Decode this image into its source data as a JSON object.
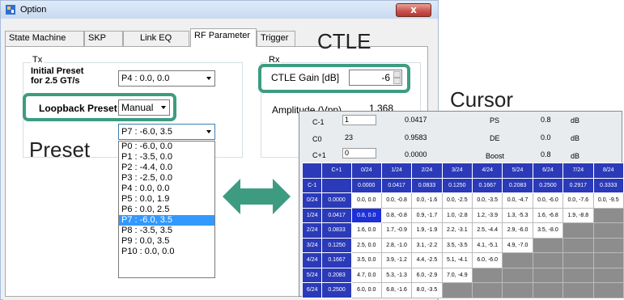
{
  "window": {
    "title": "Option",
    "close_label": "x"
  },
  "tabs": [
    {
      "label": "State Machine"
    },
    {
      "label": "SKP"
    },
    {
      "label": "Link EQ"
    },
    {
      "label": "RF Parameter"
    },
    {
      "label": "Trigger"
    }
  ],
  "tx": {
    "group_label": "Tx",
    "initial_preset_label": "Initial Preset\nfor 2.5 GT/s",
    "initial_preset_value": "P4 : 0.0, 0.0",
    "loopback_label": "Loopback Preset",
    "loopback_value": "Manual",
    "manual_value": "P7 : -6.0, 3.5"
  },
  "rx": {
    "group_label": "Rx",
    "ctle_label": "CTLE Gain [dB]",
    "ctle_value": "-6",
    "amplitude_label": "Amplitude (Vpp)",
    "amplitude_value": "1.368"
  },
  "dropdown": [
    "P0 : -6.0, 0.0",
    "P1 : -3.5, 0.0",
    "P2 : -4.4, 0.0",
    "P3 : -2.5, 0.0",
    "P4 : 0.0, 0.0",
    "P5 : 0.0, 1.9",
    "P6 : 0.0, 2.5",
    "P7 : -6.0, 3.5",
    "P8 : -3.5, 3.5",
    "P9 : 0.0, 3.5",
    "P10 : 0.0, 0.0"
  ],
  "dropdown_selected": "P7 : -6.0, 3.5",
  "annotations": {
    "ctle": "CTLE",
    "cursor": "Cursor",
    "preset": "Preset"
  },
  "cursor": {
    "c_minus1": {
      "label": "C-1",
      "value": "1",
      "computed": "0.0417"
    },
    "c0": {
      "label": "C0",
      "value": "23",
      "computed": "0.9583"
    },
    "c_plus1": {
      "label": "C+1",
      "value": "0",
      "computed": "0.0000"
    },
    "ps": {
      "label": "PS",
      "value": "0.8",
      "unit": "dB"
    },
    "de": {
      "label": "DE",
      "value": "0.0",
      "unit": "dB"
    },
    "boost": {
      "label": "Boost",
      "value": "0.8",
      "unit": "dB"
    }
  },
  "grid": {
    "corner": "C+1",
    "corner2": "C-1",
    "cols": [
      "0/24",
      "1/24",
      "2/24",
      "3/24",
      "4/24",
      "5/24",
      "6/24",
      "7/24",
      "8/24"
    ],
    "col_values": [
      "0.0000",
      "0.0417",
      "0.0833",
      "0.1250",
      "0.1667",
      "0.2083",
      "0.2500",
      "0.2917",
      "0.3333"
    ],
    "rows": [
      {
        "label": "0/24",
        "value": "0.0000",
        "cells": [
          "0.0, 0.0",
          "0.0, -0.8",
          "0.0, -1.6",
          "0.0, -2.5",
          "0.0, -3.5",
          "0.0, -4.7",
          "0.0, -6.0",
          "0.0, -7.6",
          "0.0, -9.5"
        ]
      },
      {
        "label": "1/24",
        "value": "0.0417",
        "cells": [
          "0.8, 0.0",
          "0.8, -0.8",
          "0.9, -1.7",
          "1.0, -2.8",
          "1.2, -3.9",
          "1.3, -5.3",
          "1.6, -6.8",
          "1.9, -8.8",
          ""
        ]
      },
      {
        "label": "2/24",
        "value": "0.0833",
        "cells": [
          "1.6, 0.0",
          "1.7, -0.9",
          "1.9, -1.9",
          "2.2, -3.1",
          "2.5, -4.4",
          "2.9, -6.0",
          "3.5, -8.0",
          "",
          ""
        ]
      },
      {
        "label": "3/24",
        "value": "0.1250",
        "cells": [
          "2.5, 0.0",
          "2.8, -1.0",
          "3.1, -2.2",
          "3.5, -3.5",
          "4.1, -5.1",
          "4.9, -7.0",
          "",
          "",
          ""
        ]
      },
      {
        "label": "4/24",
        "value": "0.1667",
        "cells": [
          "3.5, 0.0",
          "3.9, -1.2",
          "4.4, -2.5",
          "5.1, -4.1",
          "6.0, -6.0",
          "",
          "",
          "",
          ""
        ]
      },
      {
        "label": "5/24",
        "value": "0.2083",
        "cells": [
          "4.7, 0.0",
          "5.3, -1.3",
          "6.0, -2.9",
          "7.0, -4.9",
          "",
          "",
          "",
          "",
          ""
        ]
      },
      {
        "label": "6/24",
        "value": "0.2500",
        "cells": [
          "6.0, 0.0",
          "6.8, -1.6",
          "8.0, -3.5",
          "",
          "",
          "",
          "",
          "",
          ""
        ]
      }
    ]
  },
  "colors": {
    "callout": "#3d9c80",
    "grid_header": "#2b3ab8",
    "selected_cell": "#1d2fd8"
  }
}
